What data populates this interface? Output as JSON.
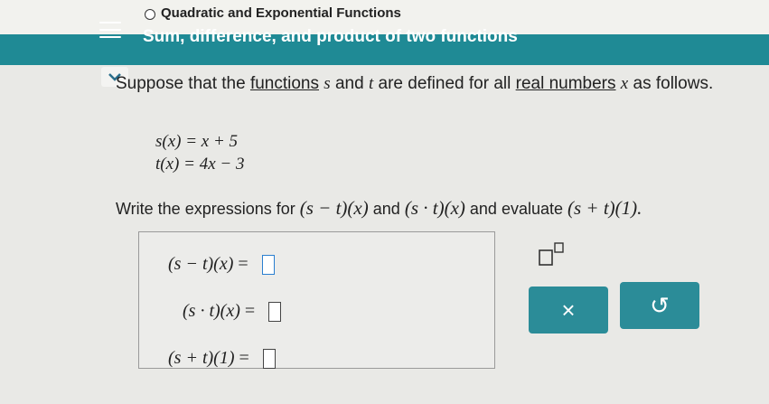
{
  "header": {
    "topic": "Quadratic and Exponential Functions",
    "lesson": "Sum, difference, and product of two functions"
  },
  "prompt": {
    "intro": "Suppose that the",
    "link_functions": "functions",
    "var_s": "s",
    "and": "and",
    "var_t": "t",
    "mid": "are defined for all",
    "link_real": "real numbers",
    "var_x": "x",
    "end": "as follows."
  },
  "definitions": [
    {
      "lhs": "s(x)",
      "rhs": "= x + 5"
    },
    {
      "lhs": "t(x)",
      "rhs": "= 4x − 3"
    }
  ],
  "instruction": {
    "lead": "Write the expressions for",
    "expr1": "(s − t)(x)",
    "and": "and",
    "expr2": "(s · t)(x)",
    "mid": "and evaluate",
    "expr3": "(s + t)(1)."
  },
  "answers": [
    {
      "label": "(s − t)(x)",
      "eq": "="
    },
    {
      "label": "(s · t)(x)",
      "eq": "="
    },
    {
      "label": "(s + t)(1)",
      "eq": "="
    }
  ],
  "buttons": {
    "clear": "×",
    "undo": "↺"
  },
  "colors": {
    "header": "#1f8a95",
    "button": "#2b8c98"
  }
}
